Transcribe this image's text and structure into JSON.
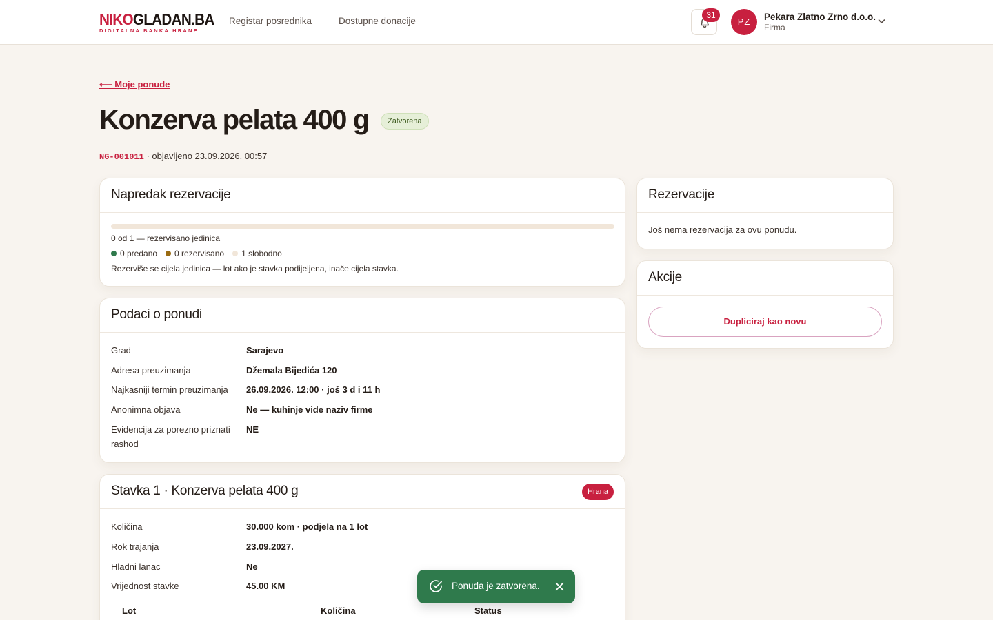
{
  "brand": {
    "logo_part1": "NIKO",
    "logo_part2": "GLADAN.BA",
    "tagline": "DIGITALNA BANKA HRANE",
    "accent_color": "#c8203f"
  },
  "nav": {
    "links": [
      "Registar posrednika",
      "Dostupne donacije"
    ]
  },
  "header": {
    "notification_count": "31",
    "avatar_initials": "PZ",
    "user_name": "Pekara Zlatno Zrno d.o.o.",
    "user_role": "Firma"
  },
  "page": {
    "back_link": "⟵ Moje ponude",
    "title": "Konzerva pelata 400 g",
    "status": "Zatvorena",
    "code": "NG-001011",
    "published": "· objavljeno 23.09.2026. 00:57"
  },
  "progress_card": {
    "title": "Napredak rezervacije",
    "progress_fraction": 0,
    "summary": "0 od 1 — rezervisano jedinica",
    "legend": [
      {
        "label": "0 predano",
        "color": "#2f7a4c"
      },
      {
        "label": "0 rezervisano",
        "color": "#9a6b12"
      },
      {
        "label": "1 slobodno",
        "color": "#f1e6d9"
      }
    ],
    "note": "Rezerviše se cijela jedinica — lot ako je stavka podijeljena, inače cijela stavka."
  },
  "offer_card": {
    "title": "Podaci o ponudi",
    "rows": [
      {
        "label": "Grad",
        "value": "Sarajevo"
      },
      {
        "label": "Adresa preuzimanja",
        "value": "Džemala Bijedića 120"
      },
      {
        "label": "Najkasniji termin preuzimanja",
        "value": "26.09.2026. 12:00 · još 3 d i 11 h"
      },
      {
        "label": "Anonimna objava",
        "value": "Ne — kuhinje vide naziv firme"
      },
      {
        "label": "Evidencija za porezno priznati rashod",
        "value": "NE"
      }
    ]
  },
  "item_card": {
    "title": "Stavka 1 · Konzerva pelata 400 g",
    "category": "Hrana",
    "rows": [
      {
        "label": "Količina",
        "value": "30.000 kom · podjela na 1 lot"
      },
      {
        "label": "Rok trajanja",
        "value": "23.09.2027."
      },
      {
        "label": "Hladni lanac",
        "value": "Ne"
      },
      {
        "label": "Vrijednost stavke",
        "value": "45.00 KM"
      }
    ],
    "lot_columns": [
      "Lot",
      "Količina",
      "Status"
    ]
  },
  "reservations_card": {
    "title": "Rezervacije",
    "empty_text": "Još nema rezervacija za ovu ponudu."
  },
  "actions_card": {
    "title": "Akcije",
    "duplicate_label": "Dupliciraj kao novu"
  },
  "toast": {
    "message": "Ponuda je zatvorena."
  }
}
